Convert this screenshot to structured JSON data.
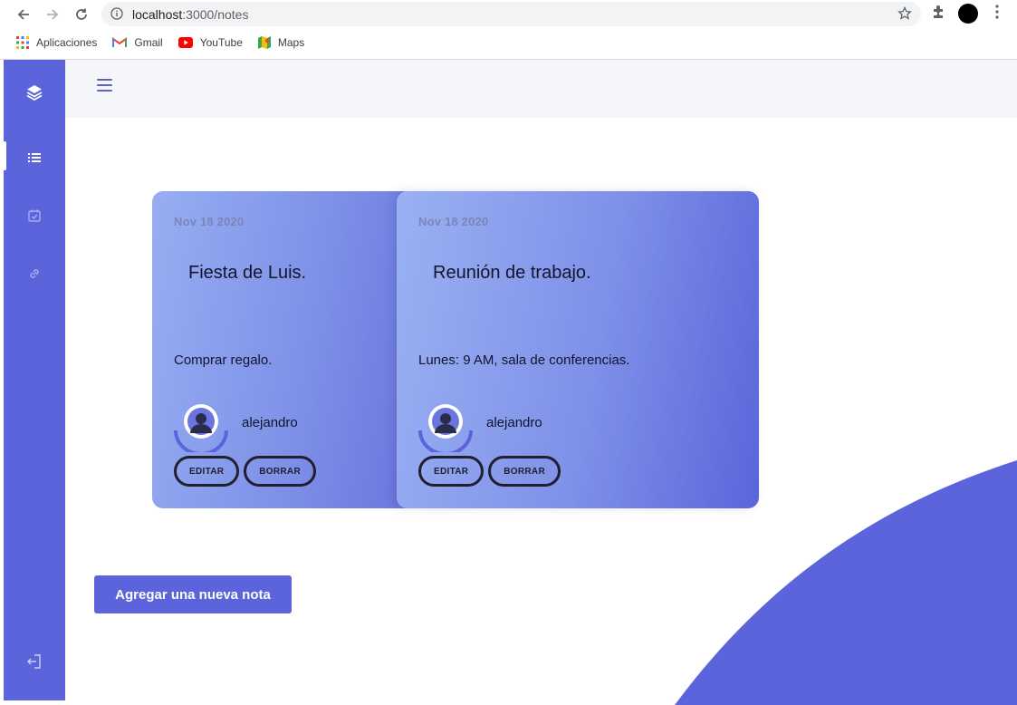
{
  "browser": {
    "url_host": "localhost",
    "url_path": ":3000/notes",
    "bookmarks": [
      {
        "label": "Aplicaciones",
        "icon": "apps-grid-icon"
      },
      {
        "label": "Gmail",
        "icon": "gmail-icon"
      },
      {
        "label": "YouTube",
        "icon": "youtube-icon"
      },
      {
        "label": "Maps",
        "icon": "maps-icon"
      }
    ]
  },
  "sidebar": {
    "items": [
      {
        "icon": "layers-icon"
      },
      {
        "icon": "list-icon",
        "active": true
      },
      {
        "icon": "calendar-check-icon"
      },
      {
        "icon": "link-icon"
      },
      {
        "icon": "logout-icon"
      }
    ]
  },
  "notes": [
    {
      "date": "Nov 18 2020",
      "title": "Fiesta de Luis.",
      "body": "Comprar regalo.",
      "author": "alejandro",
      "edit_label": "EDITAR",
      "delete_label": "BORRAR"
    },
    {
      "date": "Nov 18 2020",
      "title": "Reunión de trabajo.",
      "body": "Lunes: 9 AM, sala de conferencias.",
      "author": "alejandro",
      "edit_label": "EDITAR",
      "delete_label": "BORRAR"
    }
  ],
  "actions": {
    "add_note_label": "Agregar una nueva nota"
  },
  "colors": {
    "accent": "#5b64db",
    "card_light": "#97aef2",
    "topbar": "#f5f6fa"
  }
}
